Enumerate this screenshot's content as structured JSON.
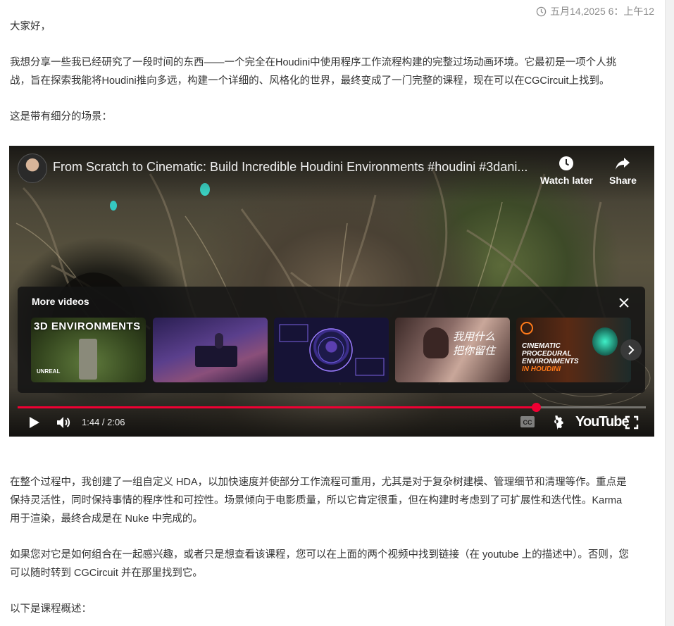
{
  "timestamp": "五月14,2025 6：上午12",
  "post": {
    "p1": "大家好，",
    "p2a": "我想分享一些我已经研究了一段时间的东西——一个完全在Houdini中使用程序工作流程构建的完整过场动画环境。它最初是一项个人挑",
    "p2b": "战，旨在探索我能将Houdini推向多远，构建一个详细的、风格化的世界，最终变成了一门完整的课程，现在可以在CGCircuit上找到。",
    "p3": "这是带有细分的场景：",
    "p4a": "在整个过程中，我创建了一组自定义 HDA，以加快速度并使部分工作流程可重用，尤其是对于复杂树建模、管理细节和清理等作。重点是",
    "p4b": "保持灵活性，同时保持事情的程序性和可控性。场景倾向于电影质量，所以它肯定很重，但在构建时考虑到了可扩展性和迭代性。Karma",
    "p4c": "用于渲染，最终合成是在 Nuke 中完成的。",
    "p5a": "如果您对它是如何组合在一起感兴趣，或者只是想查看该课程，您可以在上面的两个视频中找到链接（在 youtube 上的描述中）。否则，您",
    "p5b": "可以随时转到 CGCircuit 并在那里找到它。",
    "p6": "以下是课程概述："
  },
  "video": {
    "title": "From Scratch to Cinematic: Build Incredible Houdini Environments #houdini #3dani...",
    "watch_later": "Watch later",
    "share": "Share",
    "more_videos": "More videos",
    "thumb1_text": "3D ENVIRONMENTS",
    "thumb1_brand": "UNREAL",
    "thumb4_text": "我用什么把你留住",
    "thumb5_line1": "CINEMATIC",
    "thumb5_line2": "PROCEDURAL",
    "thumb5_line3": "ENVIRONMENTS",
    "thumb5_line4": "IN HOUDINI",
    "time": "1:44 / 2:06",
    "progress_fraction": 0.825,
    "youtube_label": "YouTube"
  },
  "colors": {
    "progress": "#f00033",
    "text": "#333333",
    "meta": "#8c8c8c"
  }
}
